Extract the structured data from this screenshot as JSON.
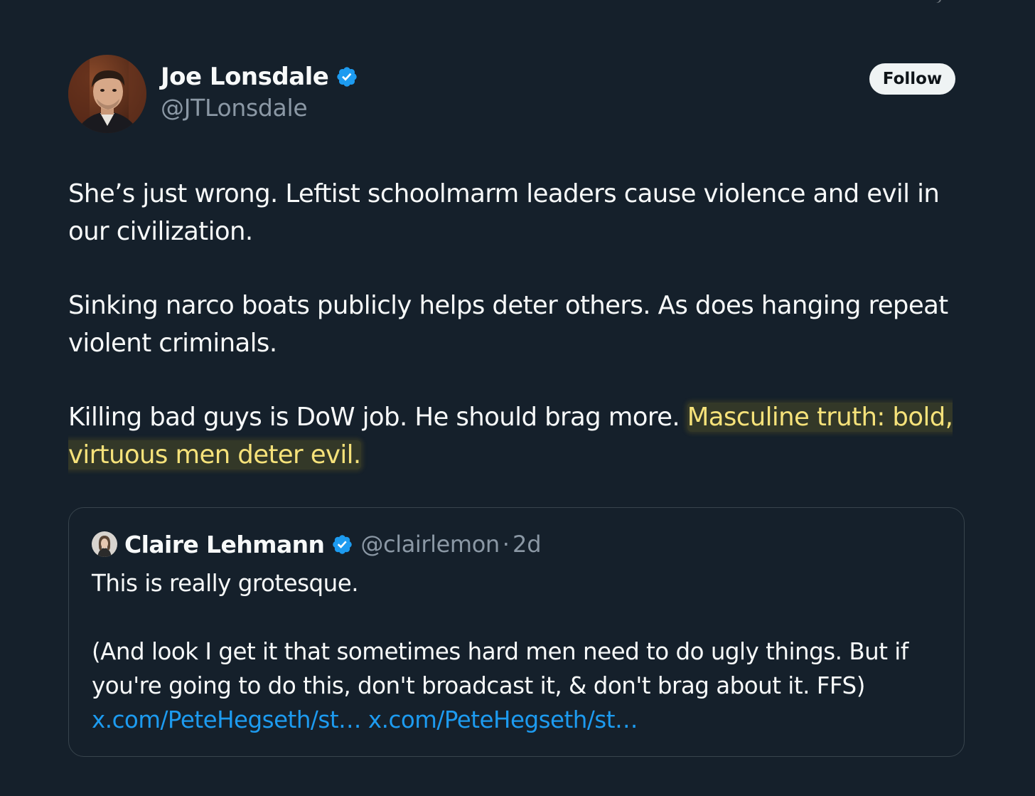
{
  "author": {
    "name": "Joe Lonsdale",
    "handle": "@JTLonsdale",
    "verified_icon": "verified-badge-icon",
    "accent": "#1d9bf0"
  },
  "follow_label": "Follow",
  "tweet": {
    "para1": "She’s just wrong. Leftist schoolmarm leaders cause violence and evil in our civilization.",
    "para2": "Sinking narco boats publicly helps deter others. As does hanging repeat violent criminals.",
    "para3_plain": "Killing bad guys is DoW job. He should brag more.",
    "para3_highlight": "Masculine truth: bold, virtuous men deter evil.",
    "highlight_color": "#f6e27a"
  },
  "quote": {
    "name": "Claire Lehmann",
    "handle": "@clairlemon",
    "separator": "·",
    "time": "2d",
    "line1": "This is really grotesque.",
    "line2": "(And look I get it that sometimes hard men need to do ugly things. But if you're going to do this, don't broadcast it, & don't brag about it. FFS)",
    "link1": "x.com/PeteHegseth/st…",
    "link2": "x.com/PeteHegseth/st…"
  }
}
